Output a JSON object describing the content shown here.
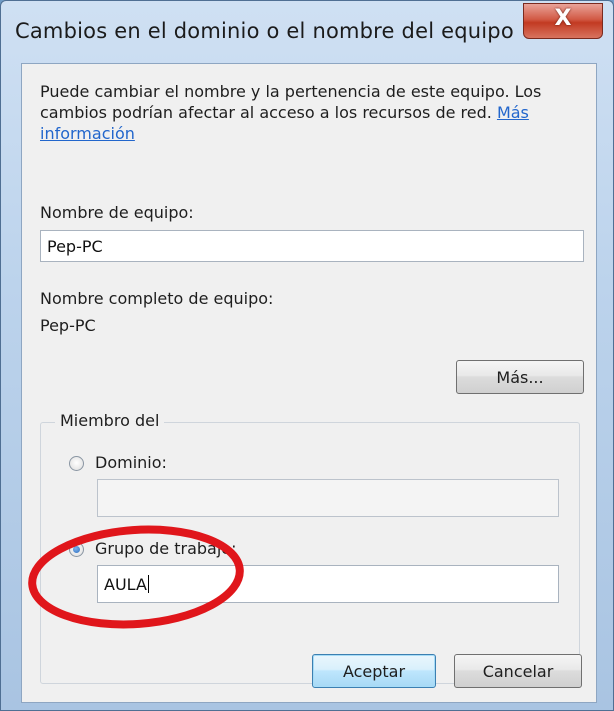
{
  "window": {
    "title": "Cambios en el dominio o el nombre del equipo",
    "close_label": "X"
  },
  "description": {
    "text": "Puede cambiar el nombre y la pertenencia de este equipo. Los cambios podrían afectar al acceso a los recursos de red. ",
    "link_text": "Más información"
  },
  "computer_name": {
    "label": "Nombre de equipo:",
    "value": "Pep-PC"
  },
  "full_computer_name": {
    "label": "Nombre completo de equipo:",
    "value": "Pep-PC"
  },
  "more_button_label": "Más...",
  "membership": {
    "legend": "Miembro del",
    "domain": {
      "label": "Dominio:",
      "value": "",
      "selected": false
    },
    "workgroup": {
      "label": "Grupo de trabajo:",
      "value": "AULA",
      "selected": true
    }
  },
  "buttons": {
    "ok": "Aceptar",
    "cancel": "Cancelar"
  },
  "colors": {
    "link": "#2266cc",
    "annotation_circle": "#e0161b",
    "close_button": "#c23a22"
  },
  "icons": [
    "close-icon",
    "radio-button",
    "text-caret"
  ]
}
